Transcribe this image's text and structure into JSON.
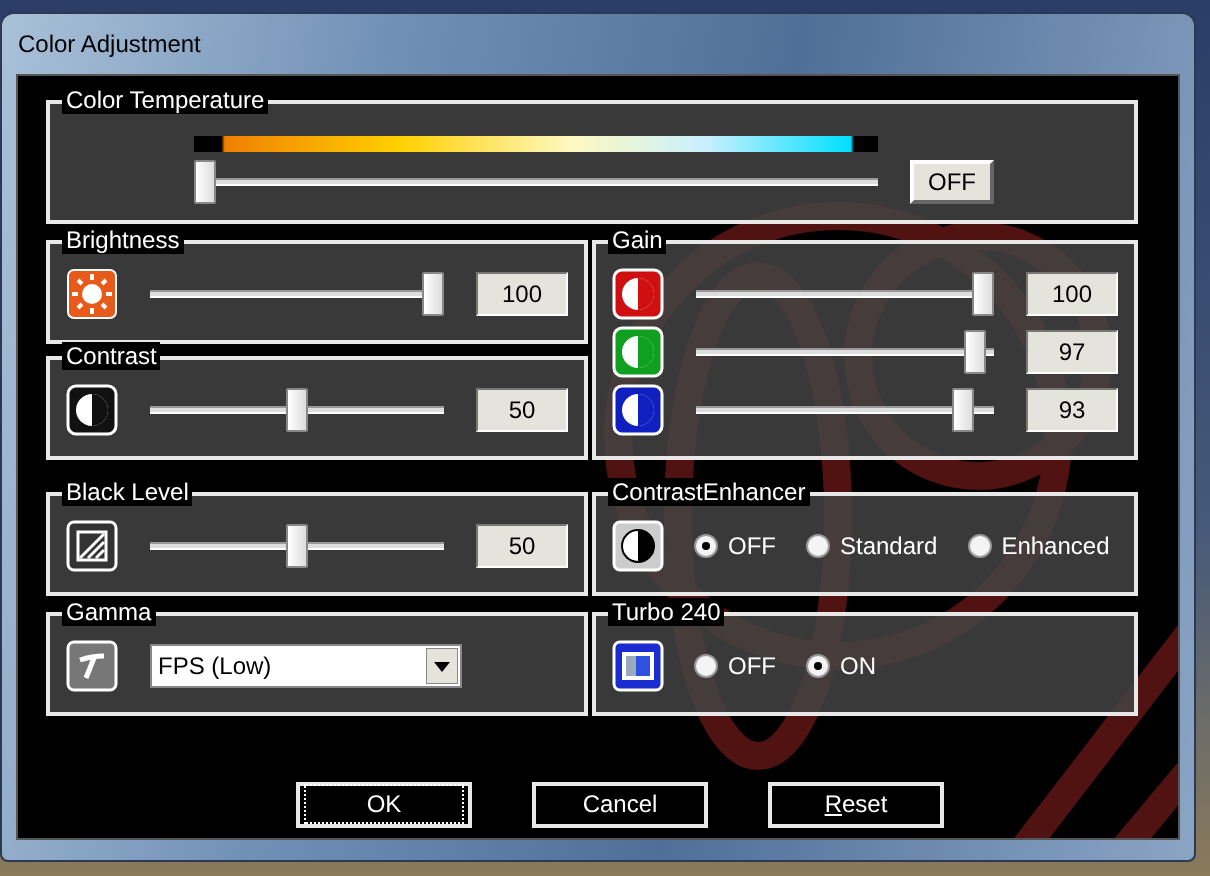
{
  "window": {
    "title": "Color Adjustment"
  },
  "color_temperature": {
    "label": "Color Temperature",
    "level": 0,
    "toggle": "OFF"
  },
  "brightness": {
    "label": "Brightness",
    "level": 1,
    "reading": "100"
  },
  "contrast": {
    "label": "Contrast",
    "level": 0.5,
    "reading": "50"
  },
  "gain": {
    "label": "Gain",
    "channels": [
      {
        "color": "#d01010",
        "level": 1,
        "reading": "100"
      },
      {
        "color": "#10a020",
        "level": 0.97,
        "reading": "97"
      },
      {
        "color": "#1020c0",
        "level": 0.93,
        "reading": "93"
      }
    ]
  },
  "black_level": {
    "label": "Black Level",
    "level": 0.5,
    "reading": "50"
  },
  "contrast_enhancer": {
    "label": "ContrastEnhancer",
    "options": [
      {
        "label": "OFF",
        "selected": true
      },
      {
        "label": "Standard",
        "selected": false
      },
      {
        "label": "Enhanced",
        "selected": false
      }
    ]
  },
  "gamma": {
    "label": "Gamma",
    "value": "FPS (Low)"
  },
  "turbo_240": {
    "label": "Turbo 240",
    "options": [
      {
        "label": "OFF",
        "selected": false
      },
      {
        "label": "ON",
        "selected": true
      }
    ]
  },
  "buttons": [
    {
      "label": "OK",
      "focused": true
    },
    {
      "label": "Cancel",
      "focused": false
    },
    {
      "label": "Reset",
      "focused": false,
      "underline_first": true
    }
  ]
}
